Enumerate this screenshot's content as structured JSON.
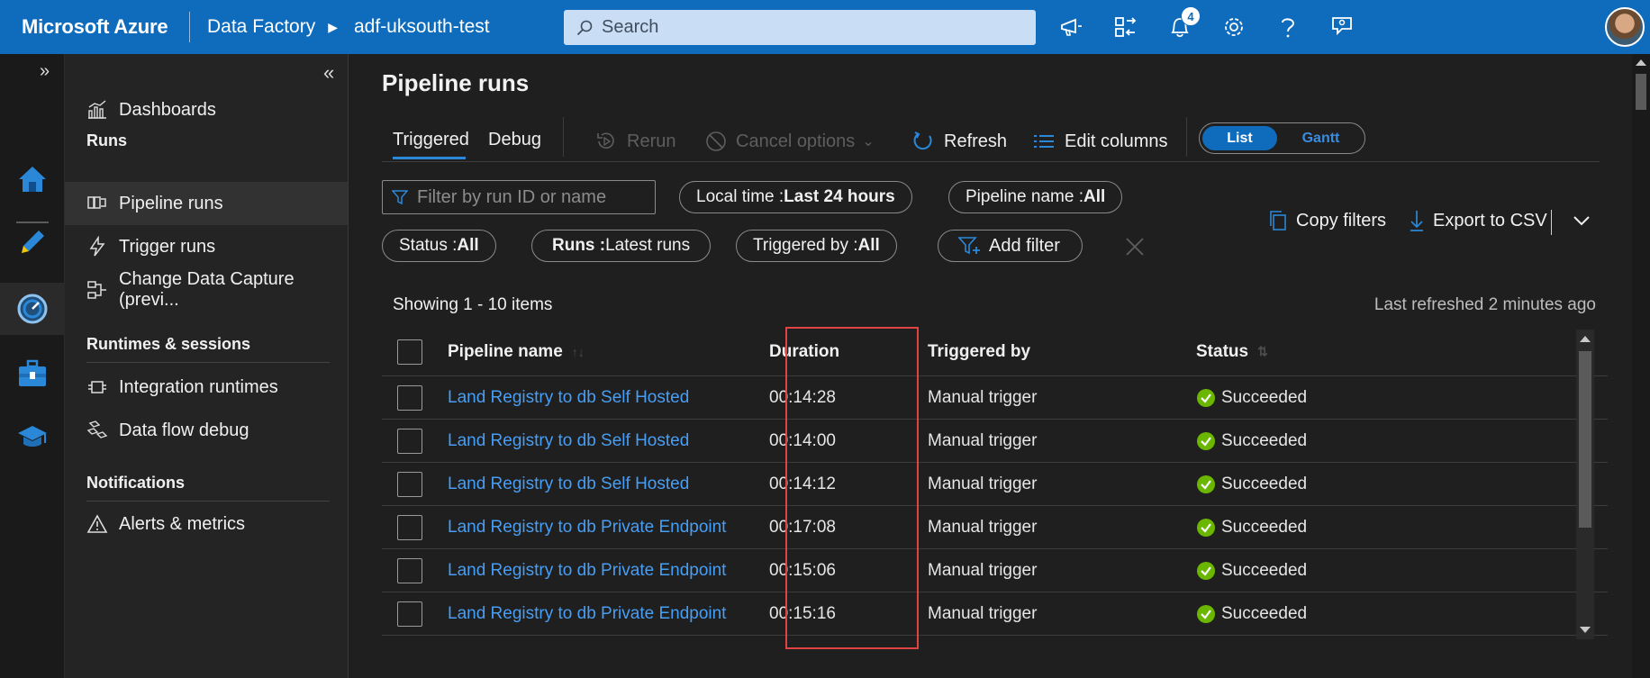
{
  "topbar": {
    "brand": "Microsoft Azure",
    "crumb_service": "Data Factory",
    "crumb_factory": "adf-uksouth-test",
    "search_placeholder": "Search",
    "notification_count": "4",
    "icons": [
      "feedback-megaphone-icon",
      "directory-switch-icon",
      "bell-icon",
      "gear-icon",
      "help-icon",
      "feedback-person-icon"
    ]
  },
  "rail": {
    "items": [
      "home-icon",
      "author-pencil-icon",
      "monitor-gauge-icon",
      "manage-toolbox-icon",
      "learning-hat-icon"
    ]
  },
  "nav": {
    "dashboards": "Dashboards",
    "section_runs": "Runs",
    "pipeline_runs": "Pipeline runs",
    "trigger_runs": "Trigger runs",
    "change_data_capture": "Change Data Capture (previ...",
    "section_runtimes": "Runtimes & sessions",
    "integration_runtimes": "Integration runtimes",
    "data_flow_debug": "Data flow debug",
    "section_notifications": "Notifications",
    "alerts_metrics": "Alerts & metrics"
  },
  "page": {
    "title": "Pipeline runs",
    "tab_triggered": "Triggered",
    "tab_debug": "Debug",
    "rerun": "Rerun",
    "cancel_options": "Cancel options",
    "refresh": "Refresh",
    "edit_columns": "Edit columns",
    "view_list": "List",
    "view_gantt": "Gantt"
  },
  "filters": {
    "search_placeholder": "Filter by run ID or name",
    "local_time_label": "Local time : ",
    "local_time_value": "Last 24 hours",
    "pipeline_name_label": "Pipeline name : ",
    "pipeline_name_value": "All",
    "status_label": "Status : ",
    "status_value": "All",
    "runs_label": "Runs : ",
    "runs_value": "Latest runs",
    "triggered_by_label": "Triggered by : ",
    "triggered_by_value": "All",
    "add_filter": "Add filter",
    "copy_filters": "Copy filters",
    "export_csv": "Export to CSV"
  },
  "grid": {
    "showing": "Showing 1 - 10 items",
    "last_refreshed": "Last refreshed 2 minutes ago",
    "columns": [
      "Pipeline name",
      "Duration",
      "Triggered by",
      "Status"
    ],
    "rows": [
      {
        "name": "Land Registry to db Self Hosted",
        "duration": "00:14:28",
        "triggered_by": "Manual trigger",
        "status": "Succeeded"
      },
      {
        "name": "Land Registry to db Self Hosted",
        "duration": "00:14:00",
        "triggered_by": "Manual trigger",
        "status": "Succeeded"
      },
      {
        "name": "Land Registry to db Self Hosted",
        "duration": "00:14:12",
        "triggered_by": "Manual trigger",
        "status": "Succeeded"
      },
      {
        "name": "Land Registry to db Private Endpoint",
        "duration": "00:17:08",
        "triggered_by": "Manual trigger",
        "status": "Succeeded"
      },
      {
        "name": "Land Registry to db Private Endpoint",
        "duration": "00:15:06",
        "triggered_by": "Manual trigger",
        "status": "Succeeded"
      },
      {
        "name": "Land Registry to db Private Endpoint",
        "duration": "00:15:16",
        "triggered_by": "Manual trigger",
        "status": "Succeeded"
      }
    ]
  },
  "colors": {
    "topbar": "#0f6cbd",
    "link": "#479ef5",
    "success": "#6bb700",
    "highlight": "#e04343"
  }
}
